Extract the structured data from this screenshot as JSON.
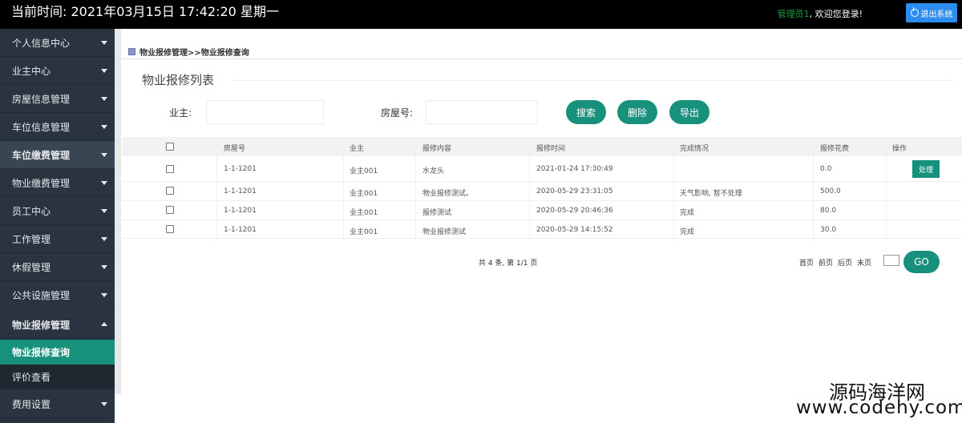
{
  "topbar": {
    "time_text": "当前时间:  2021年03月15日    17:42:20    星期一",
    "admin_name": "管理员1",
    "welcome_text": ", 欢迎您登录!",
    "logout_label": "退出系统"
  },
  "sidebar": {
    "items": [
      {
        "label": "个人信息中心"
      },
      {
        "label": "业主中心"
      },
      {
        "label": "房屋信息管理"
      },
      {
        "label": "车位信息管理"
      },
      {
        "label": "车位缴费管理"
      },
      {
        "label": "物业缴费管理"
      },
      {
        "label": "员工中心"
      },
      {
        "label": "工作管理"
      },
      {
        "label": "休假管理"
      },
      {
        "label": "公共设施管理"
      },
      {
        "label": "物业报修管理"
      }
    ],
    "sub_items": [
      {
        "label": "物业报修查询"
      },
      {
        "label": "评价查看"
      }
    ],
    "last_item": {
      "label": "费用设置"
    }
  },
  "breadcrumb": "物业报修管理>>物业报修查询",
  "panel_title": "物业报修列表",
  "search": {
    "owner_label": "业主:",
    "room_label": "房屋号:",
    "search_btn": "搜索",
    "delete_btn": "删除",
    "export_btn": "导出"
  },
  "table": {
    "headers": [
      "房屋号",
      "业主",
      "报修内容",
      "报修时间",
      "完成情况",
      "报修花费",
      "操作"
    ],
    "rows": [
      {
        "room": "1-1-1201",
        "owner": "业主001",
        "content": "水龙头",
        "time": "2021-01-24 17:30:49",
        "status": "",
        "cost": "0.0",
        "action": "处理"
      },
      {
        "room": "1-1-1201",
        "owner": "业主001",
        "content": "物业报修测试。",
        "time": "2020-05-29 23:31:05",
        "status": "天气影响, 暂不处理",
        "cost": "500.0",
        "action": ""
      },
      {
        "room": "1-1-1201",
        "owner": "业主001",
        "content": "报修测试",
        "time": "2020-05-29 20:46:36",
        "status": "完成",
        "cost": "80.0",
        "action": ""
      },
      {
        "room": "1-1-1201",
        "owner": "业主001",
        "content": "物业报修测试",
        "time": "2020-05-29 14:15:52",
        "status": "完成",
        "cost": "30.0",
        "action": ""
      }
    ]
  },
  "pagination": {
    "total_text": "共 4 条, 第 1/1 页",
    "first": "首页",
    "prev": "前页",
    "next": "后页",
    "last": "末页",
    "go": "GO"
  },
  "watermark": {
    "line1": "源码海洋网",
    "line2": "www.codehy.com"
  },
  "colors": {
    "accent": "#17907c",
    "sidebar_bg": "#2a3440",
    "logout_blue": "#2d8cf0"
  }
}
